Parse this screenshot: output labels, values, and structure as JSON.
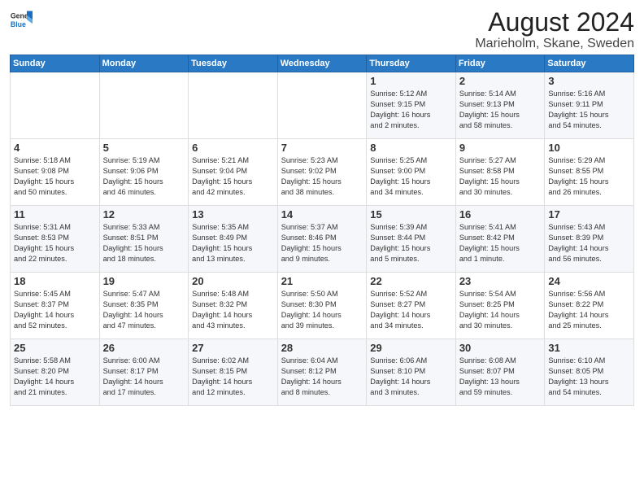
{
  "header": {
    "logo_line1": "General",
    "logo_line2": "Blue",
    "main_title": "August 2024",
    "subtitle": "Marieholm, Skane, Sweden"
  },
  "weekdays": [
    "Sunday",
    "Monday",
    "Tuesday",
    "Wednesday",
    "Thursday",
    "Friday",
    "Saturday"
  ],
  "weeks": [
    [
      {
        "day": "",
        "info": ""
      },
      {
        "day": "",
        "info": ""
      },
      {
        "day": "",
        "info": ""
      },
      {
        "day": "",
        "info": ""
      },
      {
        "day": "1",
        "info": "Sunrise: 5:12 AM\nSunset: 9:15 PM\nDaylight: 16 hours\nand 2 minutes."
      },
      {
        "day": "2",
        "info": "Sunrise: 5:14 AM\nSunset: 9:13 PM\nDaylight: 15 hours\nand 58 minutes."
      },
      {
        "day": "3",
        "info": "Sunrise: 5:16 AM\nSunset: 9:11 PM\nDaylight: 15 hours\nand 54 minutes."
      }
    ],
    [
      {
        "day": "4",
        "info": "Sunrise: 5:18 AM\nSunset: 9:08 PM\nDaylight: 15 hours\nand 50 minutes."
      },
      {
        "day": "5",
        "info": "Sunrise: 5:19 AM\nSunset: 9:06 PM\nDaylight: 15 hours\nand 46 minutes."
      },
      {
        "day": "6",
        "info": "Sunrise: 5:21 AM\nSunset: 9:04 PM\nDaylight: 15 hours\nand 42 minutes."
      },
      {
        "day": "7",
        "info": "Sunrise: 5:23 AM\nSunset: 9:02 PM\nDaylight: 15 hours\nand 38 minutes."
      },
      {
        "day": "8",
        "info": "Sunrise: 5:25 AM\nSunset: 9:00 PM\nDaylight: 15 hours\nand 34 minutes."
      },
      {
        "day": "9",
        "info": "Sunrise: 5:27 AM\nSunset: 8:58 PM\nDaylight: 15 hours\nand 30 minutes."
      },
      {
        "day": "10",
        "info": "Sunrise: 5:29 AM\nSunset: 8:55 PM\nDaylight: 15 hours\nand 26 minutes."
      }
    ],
    [
      {
        "day": "11",
        "info": "Sunrise: 5:31 AM\nSunset: 8:53 PM\nDaylight: 15 hours\nand 22 minutes."
      },
      {
        "day": "12",
        "info": "Sunrise: 5:33 AM\nSunset: 8:51 PM\nDaylight: 15 hours\nand 18 minutes."
      },
      {
        "day": "13",
        "info": "Sunrise: 5:35 AM\nSunset: 8:49 PM\nDaylight: 15 hours\nand 13 minutes."
      },
      {
        "day": "14",
        "info": "Sunrise: 5:37 AM\nSunset: 8:46 PM\nDaylight: 15 hours\nand 9 minutes."
      },
      {
        "day": "15",
        "info": "Sunrise: 5:39 AM\nSunset: 8:44 PM\nDaylight: 15 hours\nand 5 minutes."
      },
      {
        "day": "16",
        "info": "Sunrise: 5:41 AM\nSunset: 8:42 PM\nDaylight: 15 hours\nand 1 minute."
      },
      {
        "day": "17",
        "info": "Sunrise: 5:43 AM\nSunset: 8:39 PM\nDaylight: 14 hours\nand 56 minutes."
      }
    ],
    [
      {
        "day": "18",
        "info": "Sunrise: 5:45 AM\nSunset: 8:37 PM\nDaylight: 14 hours\nand 52 minutes."
      },
      {
        "day": "19",
        "info": "Sunrise: 5:47 AM\nSunset: 8:35 PM\nDaylight: 14 hours\nand 47 minutes."
      },
      {
        "day": "20",
        "info": "Sunrise: 5:48 AM\nSunset: 8:32 PM\nDaylight: 14 hours\nand 43 minutes."
      },
      {
        "day": "21",
        "info": "Sunrise: 5:50 AM\nSunset: 8:30 PM\nDaylight: 14 hours\nand 39 minutes."
      },
      {
        "day": "22",
        "info": "Sunrise: 5:52 AM\nSunset: 8:27 PM\nDaylight: 14 hours\nand 34 minutes."
      },
      {
        "day": "23",
        "info": "Sunrise: 5:54 AM\nSunset: 8:25 PM\nDaylight: 14 hours\nand 30 minutes."
      },
      {
        "day": "24",
        "info": "Sunrise: 5:56 AM\nSunset: 8:22 PM\nDaylight: 14 hours\nand 25 minutes."
      }
    ],
    [
      {
        "day": "25",
        "info": "Sunrise: 5:58 AM\nSunset: 8:20 PM\nDaylight: 14 hours\nand 21 minutes."
      },
      {
        "day": "26",
        "info": "Sunrise: 6:00 AM\nSunset: 8:17 PM\nDaylight: 14 hours\nand 17 minutes."
      },
      {
        "day": "27",
        "info": "Sunrise: 6:02 AM\nSunset: 8:15 PM\nDaylight: 14 hours\nand 12 minutes."
      },
      {
        "day": "28",
        "info": "Sunrise: 6:04 AM\nSunset: 8:12 PM\nDaylight: 14 hours\nand 8 minutes."
      },
      {
        "day": "29",
        "info": "Sunrise: 6:06 AM\nSunset: 8:10 PM\nDaylight: 14 hours\nand 3 minutes."
      },
      {
        "day": "30",
        "info": "Sunrise: 6:08 AM\nSunset: 8:07 PM\nDaylight: 13 hours\nand 59 minutes."
      },
      {
        "day": "31",
        "info": "Sunrise: 6:10 AM\nSunset: 8:05 PM\nDaylight: 13 hours\nand 54 minutes."
      }
    ]
  ]
}
